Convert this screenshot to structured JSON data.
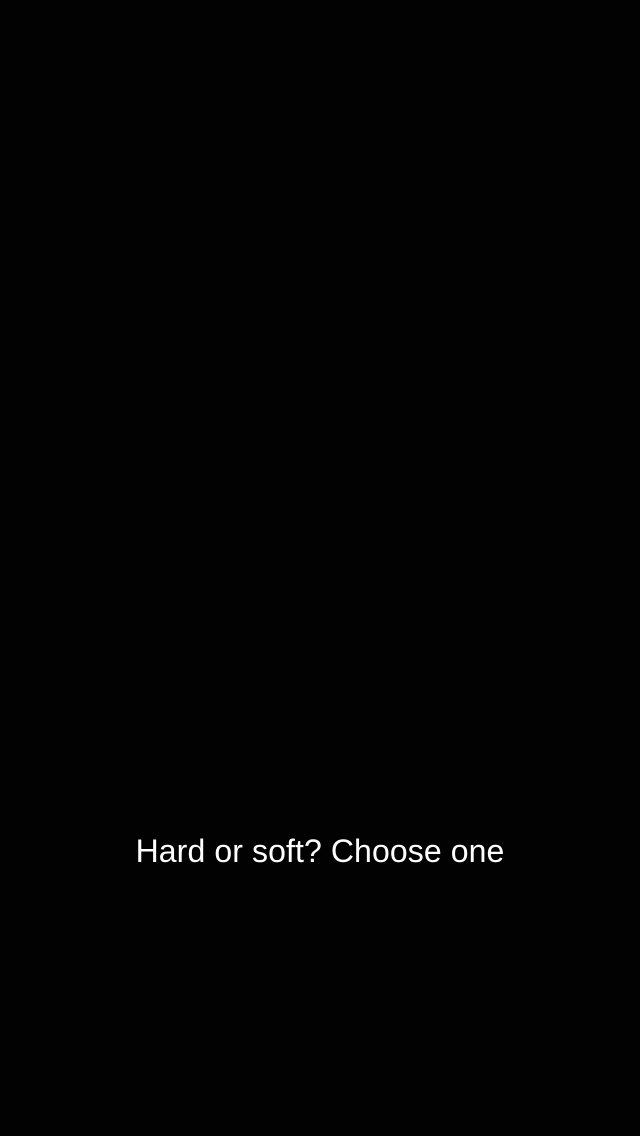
{
  "caption": {
    "text": "Hard or soft? Choose one",
    "color": "#ffffff"
  },
  "background": {
    "color": "#030203"
  }
}
